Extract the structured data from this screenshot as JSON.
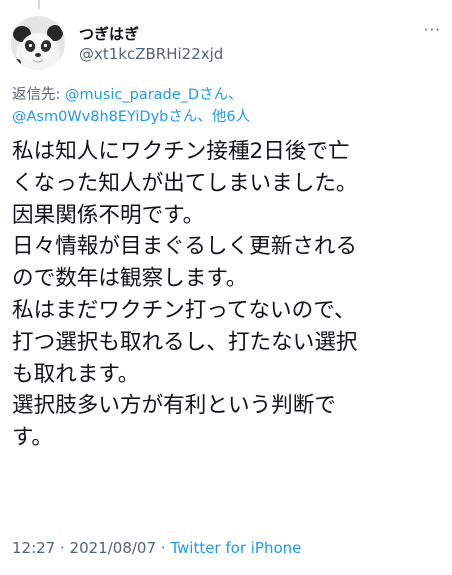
{
  "user": {
    "display_name": "つぎはぎ",
    "handle": "@xt1kcZBRHi22xjd"
  },
  "more_label": "···",
  "reply": {
    "prefix": "返信先: ",
    "mention1": "@music_parade_D",
    "san1": "さん、",
    "mention2": "@Asm0Wv8h8EYiDyb",
    "san2": "さん、",
    "others": "他6人"
  },
  "tweet_lines": [
    "私は知人にワクチン接種2日後で亡",
    "くなった知人が出てしまいました。",
    "因果関係不明です。",
    "日々情報が目まぐるしく更新される",
    "ので数年は観察します。",
    "私はまだワクチン打ってないので、",
    "打つ選択も取れるし、打たない選択",
    "も取れます。",
    "選択肢多い方が有利という判断で",
    "す。"
  ],
  "meta": {
    "time": "12:27",
    "sep1": " · ",
    "date": "2021/08/07",
    "sep2": " · ",
    "source": "Twitter for iPhone"
  },
  "colors": {
    "link": "#1d9bf0",
    "secondary": "#536471",
    "text": "#0f1419"
  }
}
